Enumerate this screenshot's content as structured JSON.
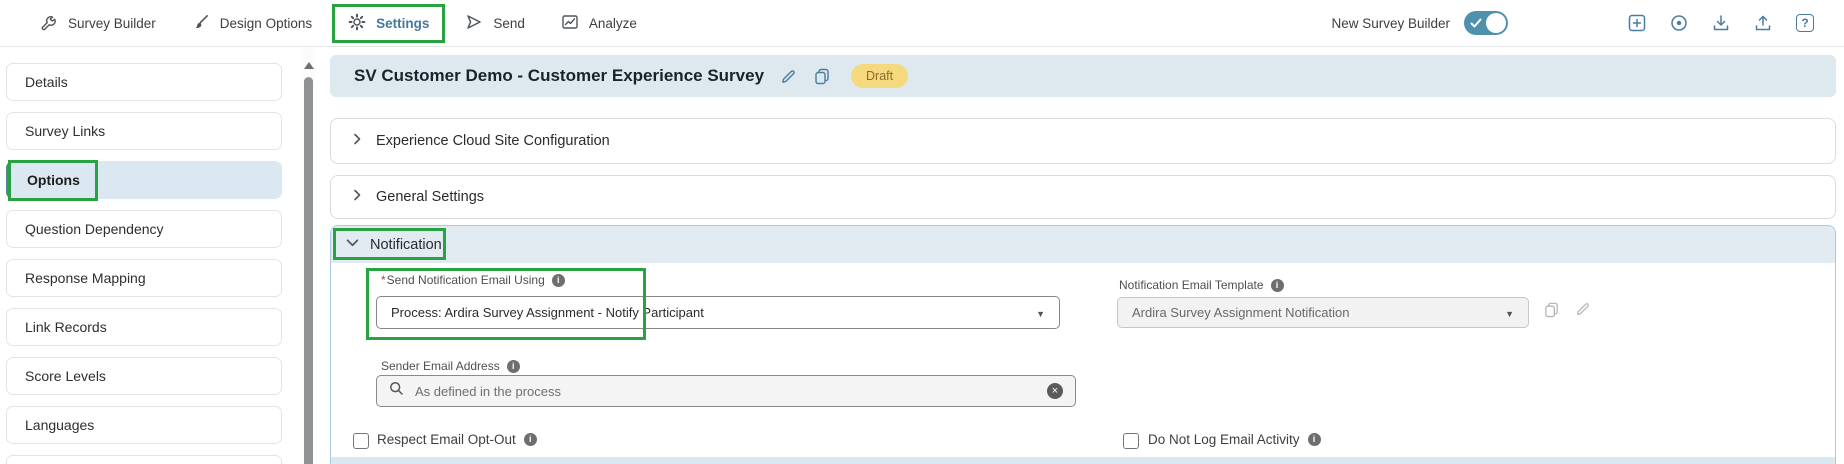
{
  "topnav": {
    "items": [
      {
        "label": "Survey Builder"
      },
      {
        "label": "Design Options"
      },
      {
        "label": "Settings"
      },
      {
        "label": "Send"
      },
      {
        "label": "Analyze"
      }
    ],
    "new_survey_builder_label": "New Survey Builder",
    "toggle_state": "on"
  },
  "sidebar": {
    "items": [
      {
        "label": "Details"
      },
      {
        "label": "Survey Links"
      },
      {
        "label": "Options"
      },
      {
        "label": "Question Dependency"
      },
      {
        "label": "Response Mapping"
      },
      {
        "label": "Link Records"
      },
      {
        "label": "Score Levels"
      },
      {
        "label": "Languages"
      }
    ],
    "selected": "Options"
  },
  "header": {
    "title": "SV Customer Demo - Customer Experience Survey",
    "status_badge": "Draft"
  },
  "sections": {
    "experience_cloud": {
      "label": "Experience Cloud Site Configuration",
      "expanded": false
    },
    "general_settings": {
      "label": "General Settings",
      "expanded": false
    },
    "notification": {
      "label": "Notification",
      "expanded": true
    }
  },
  "notification_form": {
    "required_marker": "*",
    "send_using_label": "Send Notification Email Using",
    "send_using_value": "Process: Ardira Survey Assignment - Notify Participant",
    "template_label": "Notification Email Template",
    "template_value": "Ardira Survey Assignment Notification",
    "sender_label": "Sender Email Address",
    "sender_placeholder": "As defined in the process",
    "checkbox_respect_label": "Respect Email Opt-Out",
    "checkbox_respect_checked": false,
    "checkbox_do_not_log_label": "Do Not Log Email Activity",
    "checkbox_do_not_log_checked": false
  },
  "colors": {
    "annotation_green": "#27a341",
    "accent_steel_blue": "#4a7ca0",
    "toggle_teal": "#4f90ad",
    "draft_badge_bg": "#f6d87e",
    "draft_badge_text": "#8a6d2a",
    "panel_header_bg": "#dee9ef",
    "selected_sidebar_bg": "#dbe8f1"
  }
}
